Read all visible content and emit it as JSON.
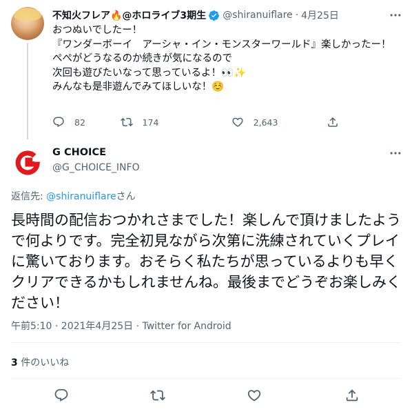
{
  "parent_tweet": {
    "author_name": "不知火フレア🔥@ホロライブ3期生",
    "handle": "@shiranuiflare",
    "separator": "·",
    "date": "4月25日",
    "text": "おつぬいでしたー！\n『ワンダーボーイ　アーシャ・イン・モンスターワールド』楽しかったー！\nぺぺがどうなるのか続きが気になるので\n次回も遊びたいなって思っているよ！👀✨\nみんなも是非遊んでみてほしいな！☺️",
    "reply_count": "82",
    "retweet_count": "174",
    "like_count": "2,643"
  },
  "reply_tweet": {
    "author_name": "G CHOICE",
    "handle": "@G_CHOICE_INFO",
    "reply_to_label": "返信先: ",
    "reply_to_handle": "@shiranuiflare",
    "reply_to_suffix": "さん",
    "text": "長時間の配信おつかれさまでした！楽しんで頂けましたようで何よりです。完全初見ながら次第に洗練されていくプレイに驚いております。おそらく私たちが思っているよりも早くクリアできるかもしれませんね。最後までどうぞお楽しみください！",
    "timestamp": "午前5:10 · 2021年4月25日 · Twitter for Android",
    "like_count": "3",
    "like_label": " 件のいいね"
  },
  "icons": [
    "verified-icon",
    "more-icon",
    "reply-icon",
    "retweet-icon",
    "like-icon",
    "share-icon"
  ],
  "colors": {
    "accent": "#1d9bf0",
    "muted": "#536471",
    "text": "#0f1419",
    "brand_red": "#e0191e"
  }
}
